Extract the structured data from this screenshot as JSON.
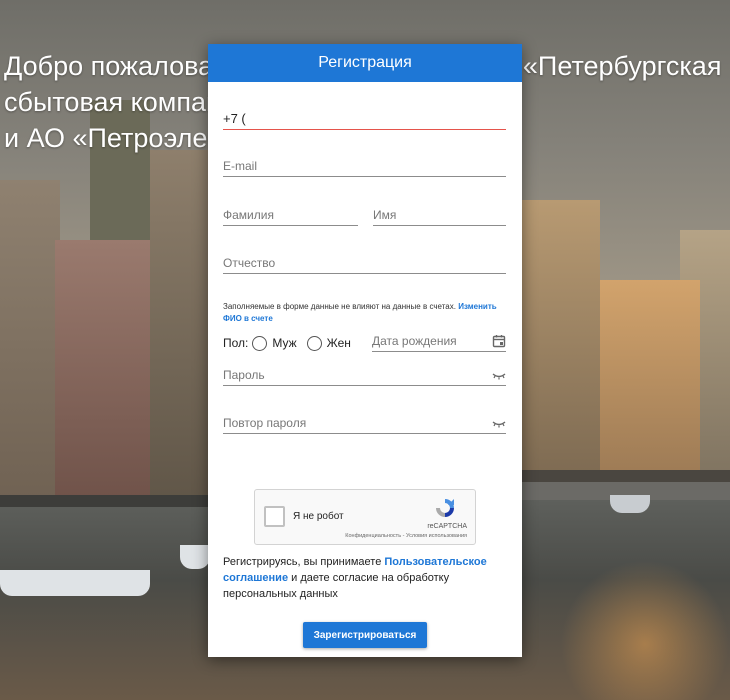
{
  "background": {
    "headline": "Добро пожаловать в личный кабинет АО «Петербургская сбытовая компания»\nи АО «Петроэлектросбыт»"
  },
  "modal": {
    "title": "Регистрация",
    "fields": {
      "phone_value": "+7 (",
      "email_placeholder": "E-mail",
      "last_name_placeholder": "Фамилия",
      "first_name_placeholder": "Имя",
      "middle_name_placeholder": "Отчество",
      "birth_date_placeholder": "Дата рождения",
      "password_placeholder": "Пароль",
      "password_repeat_placeholder": "Повтор пароля"
    },
    "note": {
      "text": "Заполняемые в форме данные не влияют на данные в счетах. ",
      "link": "Изменить ФИО в счете"
    },
    "gender": {
      "label": "Пол:",
      "male": "Муж",
      "female": "Жен"
    },
    "captcha": {
      "label": "Я не робот",
      "brand": "reCAPTCHA",
      "privacy": "Конфиденциальность - Условия использования"
    },
    "terms": {
      "prefix": "Регистрируясь, вы принимаете ",
      "link": "Пользовательское соглашение",
      "suffix": " и даете согласие на обработку персональных данных"
    },
    "submit_label": "Зарегистрироваться"
  },
  "colors": {
    "accent": "#1e77d6",
    "error_underline": "#e5534b"
  }
}
